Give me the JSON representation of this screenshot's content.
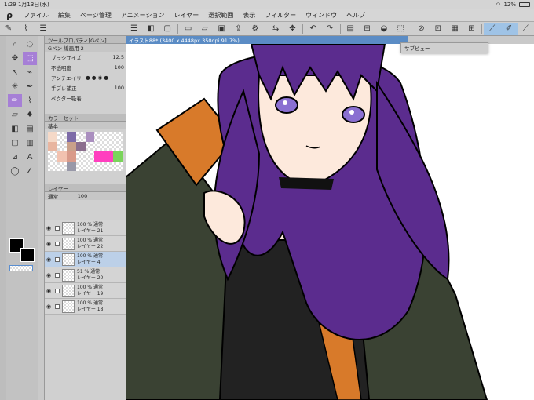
{
  "status": {
    "time": "1:29",
    "date": "1月13日(水)",
    "battery": "12%"
  },
  "menu": [
    "ファイル",
    "編集",
    "ページ管理",
    "アニメーション",
    "レイヤー",
    "選択範囲",
    "表示",
    "フィルター",
    "ウィンドウ",
    "ヘルプ"
  ],
  "tool_property": {
    "title": "ツールプロパティ[Gペン]",
    "sub": "Gペン 線画用 2",
    "brush_size_label": "ブラシサイズ",
    "brush_size": "12.5",
    "opacity_label": "不透明度",
    "opacity": "100",
    "antialias_label": "アンチエイリ",
    "stabilize_label": "手ブレ補正",
    "stabilize": "100",
    "vector_label": "ベクター吸着"
  },
  "colorset": {
    "title": "カラーセット",
    "set_name": "基本"
  },
  "layers": {
    "title": "レイヤー",
    "blend": "通常",
    "opacity": "100",
    "items": [
      {
        "pct": "100 %",
        "mode": "通常",
        "name": "レイヤー 21"
      },
      {
        "pct": "100 %",
        "mode": "通常",
        "name": "レイヤー 22"
      },
      {
        "pct": "100 %",
        "mode": "通常",
        "name": "レイヤー 4"
      },
      {
        "pct": "51 %",
        "mode": "通常",
        "name": "レイヤー 20"
      },
      {
        "pct": "100 %",
        "mode": "通常",
        "name": "レイヤー 19"
      },
      {
        "pct": "100 %",
        "mode": "通常",
        "name": "レイヤー 18"
      }
    ]
  },
  "canvas": {
    "tab": "イラスト88* (3400 x 4448px 350dpi 91.7%)",
    "subview": "サブビュー"
  },
  "colors": {
    "hair": "#5b2c8e",
    "jacket": "#3a4233",
    "accent": "#d87a2a",
    "skin": "#fde9dc",
    "eye": "#8a6fd1",
    "selection": "#a67fd6"
  }
}
